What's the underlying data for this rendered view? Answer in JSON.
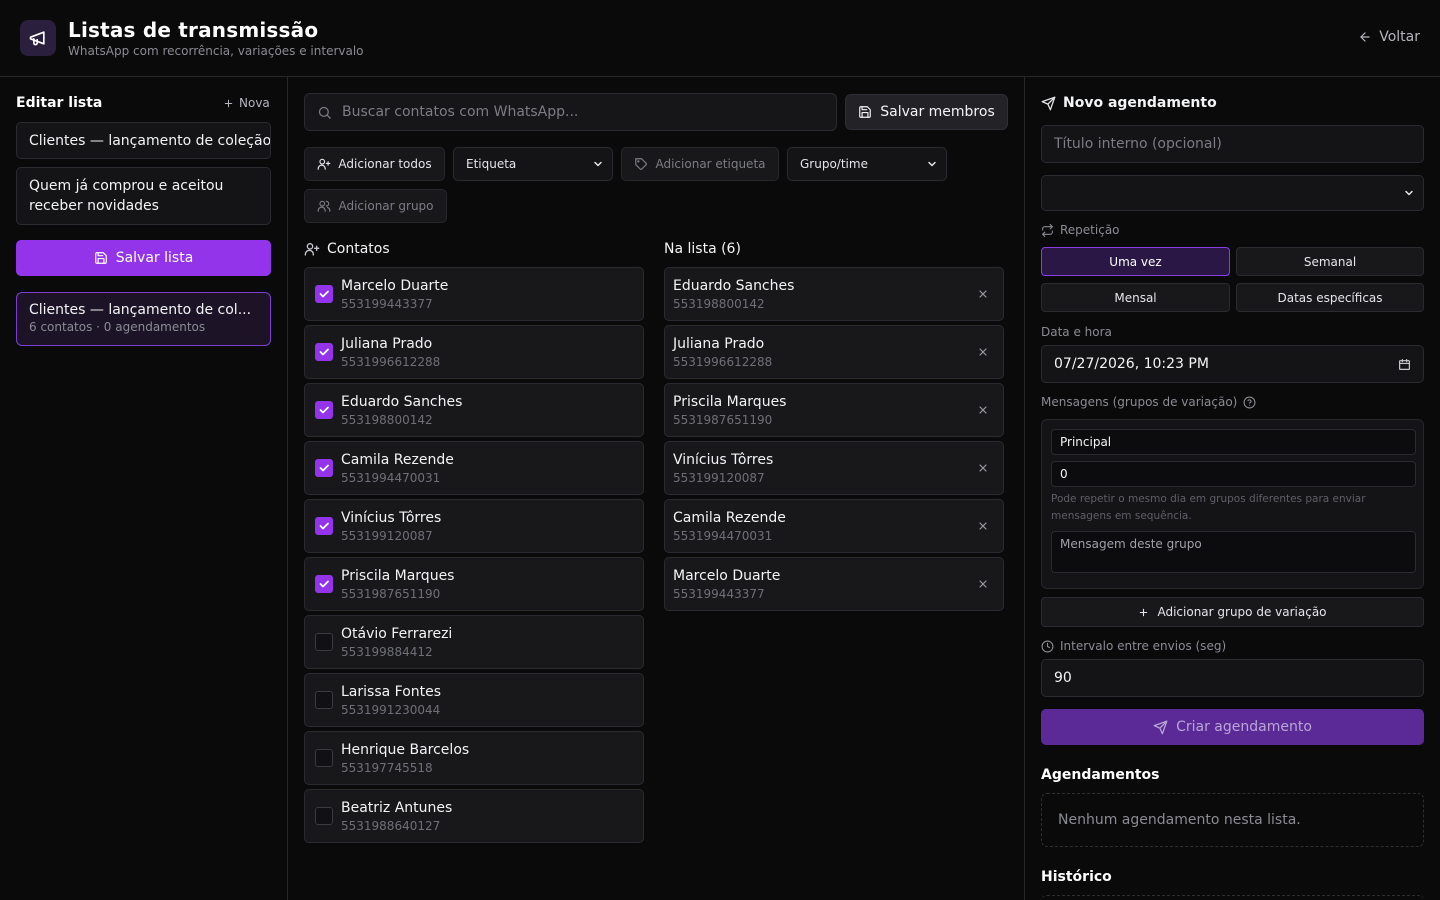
{
  "header": {
    "title": "Listas de transmissão",
    "subtitle": "WhatsApp com recorrência, variações e intervalo",
    "back_label": "Voltar"
  },
  "editor": {
    "title": "Editar lista",
    "new_label": "Nova",
    "name_value": "Clientes — lançamento de coleção",
    "description_value": "Quem já comprou e aceitou receber novidades",
    "save_label": "Salvar lista"
  },
  "lists": [
    {
      "name": "Clientes — lançamento de col...",
      "meta": "6 contatos · 0 agendamentos"
    }
  ],
  "search": {
    "placeholder": "Buscar contatos com WhatsApp..."
  },
  "toolbar": {
    "save_members": "Salvar membros",
    "add_all": "Adicionar todos",
    "tag_select": "Etiqueta",
    "add_tag": "Adicionar etiqueta",
    "group_select": "Grupo/time",
    "add_group": "Adicionar grupo"
  },
  "contacts_title": "Contatos",
  "contacts": [
    {
      "name": "Marcelo Duarte",
      "phone": "553199443377",
      "checked": true
    },
    {
      "name": "Juliana Prado",
      "phone": "5531996612288",
      "checked": true
    },
    {
      "name": "Eduardo Sanches",
      "phone": "553198800142",
      "checked": true
    },
    {
      "name": "Camila Rezende",
      "phone": "5531994470031",
      "checked": true
    },
    {
      "name": "Vinícius Tôrres",
      "phone": "553199120087",
      "checked": true
    },
    {
      "name": "Priscila Marques",
      "phone": "5531987651190",
      "checked": true
    },
    {
      "name": "Otávio Ferrarezi",
      "phone": "553199884412",
      "checked": false
    },
    {
      "name": "Larissa Fontes",
      "phone": "5531991230044",
      "checked": false
    },
    {
      "name": "Henrique Barcelos",
      "phone": "553197745518",
      "checked": false
    },
    {
      "name": "Beatriz Antunes",
      "phone": "5531988640127",
      "checked": false
    }
  ],
  "members_title": "Na lista (6)",
  "members": [
    {
      "name": "Eduardo Sanches",
      "phone": "553198800142"
    },
    {
      "name": "Juliana Prado",
      "phone": "5531996612288"
    },
    {
      "name": "Priscila Marques",
      "phone": "5531987651190"
    },
    {
      "name": "Vinícius Tôrres",
      "phone": "553199120087"
    },
    {
      "name": "Camila Rezende",
      "phone": "5531994470031"
    },
    {
      "name": "Marcelo Duarte",
      "phone": "553199443377"
    }
  ],
  "schedule": {
    "title": "Novo agendamento",
    "title_placeholder": "Título interno (opcional)",
    "select_value": "",
    "repeat_label": "Repetição",
    "repeat_options": [
      "Uma vez",
      "Semanal",
      "Mensal",
      "Datas específicas"
    ],
    "repeat_selected": "Uma vez",
    "datetime_label": "Data e hora",
    "datetime_value": "07/27/2026, 10:23 PM",
    "messages_label": "Mensagens (grupos de variação)",
    "group_name": "Principal",
    "group_day": "0",
    "group_hint": "Pode repetir o mesmo dia em grupos diferentes para enviar mensagens em sequência.",
    "message_placeholder": "Mensagem deste grupo",
    "add_variation": "Adicionar grupo de variação",
    "interval_label": "Intervalo entre envios (seg)",
    "interval_value": "90",
    "create_label": "Criar agendamento"
  },
  "schedules_title": "Agendamentos",
  "schedules_empty": "Nenhum agendamento nesta lista.",
  "history_title": "Histórico",
  "colors": {
    "accent": "#9333ea",
    "background": "#0a0a0b",
    "card": "#18181b"
  }
}
